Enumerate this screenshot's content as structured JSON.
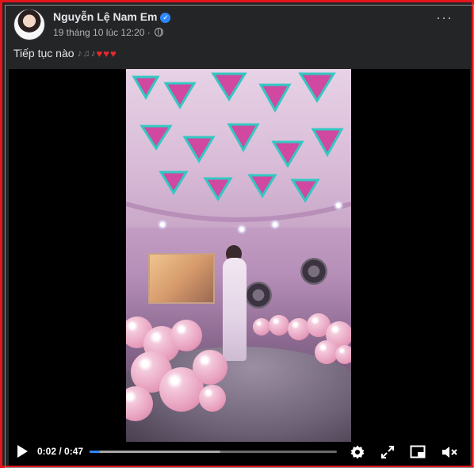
{
  "post": {
    "author": "Nguyễn Lệ Nam Em",
    "timestamp": "19 tháng 10 lúc 12:20 ·",
    "audience_icon": "globe-icon",
    "verified_icon": "verified-badge-icon",
    "caption": "Tiếp tục nào"
  },
  "video": {
    "current_time": "0:02",
    "duration": "0:47",
    "time_display": "0:02 / 0:47",
    "progress_fraction": 0.0426,
    "buffer_fraction": 0.53,
    "icons": [
      "play-icon",
      "settings-icon",
      "fullscreen-icon",
      "picture-in-picture-icon",
      "mute-icon"
    ]
  },
  "colors": {
    "background": "#242526",
    "border": "#e3161c",
    "text_primary": "#e4e6eb",
    "text_secondary": "#b0b3b8",
    "accent": "#2d88ff"
  }
}
